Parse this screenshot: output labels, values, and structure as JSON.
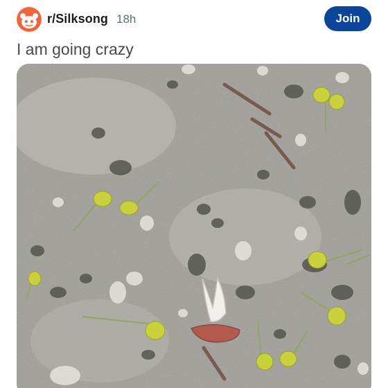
{
  "post": {
    "subreddit": "r/Silksong",
    "time_ago": "18h",
    "join_label": "Join",
    "title": "I am going crazy"
  },
  "image": {
    "subject": "gravel-ground-with-fallen-flowers"
  },
  "colors": {
    "join_button": "#0a449b",
    "subreddit_avatar": "#f2643a",
    "title_text": "#4a4a4a",
    "meta_text": "#576f76"
  },
  "icons": {
    "avatar": "reddit-snoo-icon"
  }
}
